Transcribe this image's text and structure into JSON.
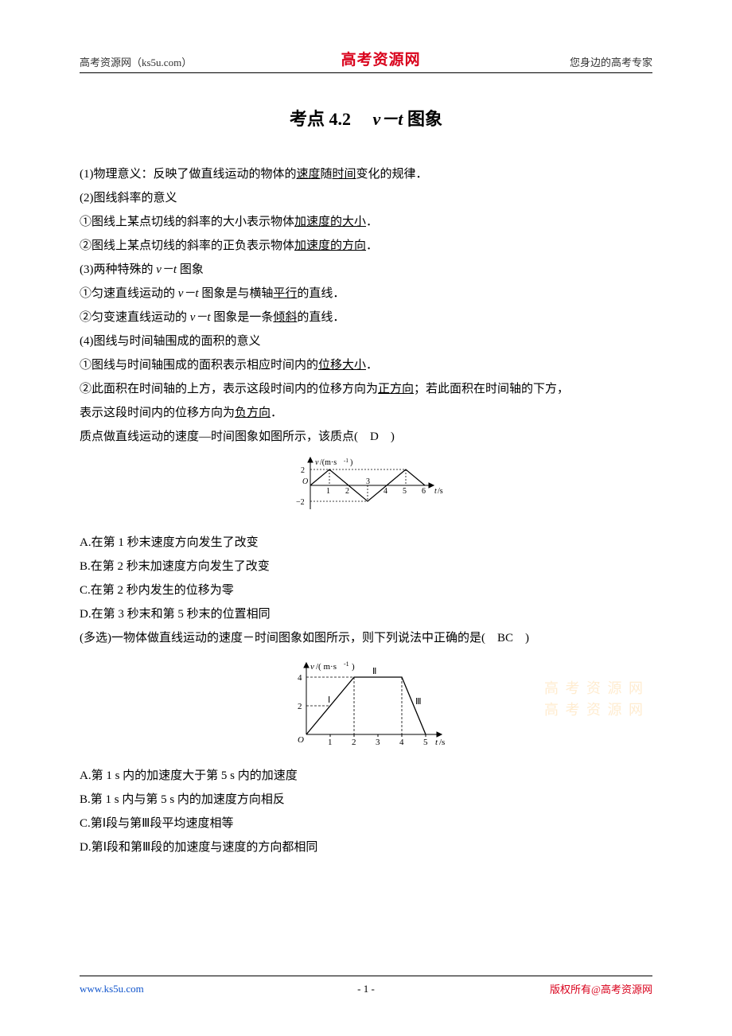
{
  "header": {
    "left": "高考资源网（ks5u.com）",
    "center": "高考资源网",
    "right": "您身边的高考专家"
  },
  "title": {
    "prefix": "考点 4.2",
    "varPart": "v－t",
    "suffix": " 图象"
  },
  "content": {
    "p1a": "(1)物理意义：反映了做直线运动的物体的",
    "p1u1": "速度",
    "p1b": "随",
    "p1u2": "时间",
    "p1c": "变化的规律．",
    "p2": "(2)图线斜率的意义",
    "p3a": "①图线上某点切线的斜率的大小表示物体",
    "p3u": "加速度的大小",
    "p3b": "．",
    "p4a": "②图线上某点切线的斜率的正负表示物体",
    "p4u": "加速度的方向",
    "p4b": "．",
    "p5a": "(3)两种特殊的 ",
    "p5v": "v－t",
    "p5b": " 图象",
    "p6a": "①匀速直线运动的 ",
    "p6v": "v－t",
    "p6b": " 图象是与横轴",
    "p6u": "平行",
    "p6c": "的直线．",
    "p7a": "②匀变速直线运动的 ",
    "p7v": "v－t",
    "p7b": " 图象是一条",
    "p7u": "倾斜",
    "p7c": "的直线．",
    "p8": "(4)图线与时间轴围成的面积的意义",
    "p9a": "①图线与时间轴围成的面积表示相应时间内的",
    "p9u": "位移大小",
    "p9b": "．",
    "p10a": "②此面积在时间轴的上方，表示这段时间内的位移方向为",
    "p10u1": "正方向",
    "p10b": "；若此面积在时间轴的下方，",
    "p10c": "表示这段时间内的位移方向为",
    "p10u2": "负方向",
    "p10d": "．",
    "q1stem": "质点做直线运动的速度—时间图象如图所示，该质点(　D　)",
    "q1A": "A.在第 1 秒末速度方向发生了改变",
    "q1B": "B.在第 2 秒末加速度方向发生了改变",
    "q1C": "C.在第 2 秒内发生的位移为零",
    "q1D": "D.在第 3 秒末和第 5 秒末的位置相同",
    "q2stem": " (多选)一物体做直线运动的速度－时间图象如图所示，则下列说法中正确的是(　BC　)",
    "q2A": "A.第 1 s 内的加速度大于第 5 s 内的加速度",
    "q2B": "B.第 1 s 内与第 5 s 内的加速度方向相反",
    "q2C": "C.第Ⅰ段与第Ⅲ段平均速度相等",
    "q2D": "D.第Ⅰ段和第Ⅲ段的加速度与速度的方向都相同"
  },
  "footer": {
    "left": "www.ks5u.com",
    "center": "- 1 -",
    "right": "版权所有@高考资源网"
  },
  "watermark": {
    "line1": "高 考 资 源 网",
    "line2": "高 考 资 源 网"
  },
  "chart_data": [
    {
      "type": "line",
      "title": "",
      "xlabel": "t/s",
      "ylabel": "v/(m·s⁻¹)",
      "x": [
        0,
        1,
        2,
        3,
        4,
        5,
        6
      ],
      "y": [
        0,
        2,
        0,
        -2,
        0,
        2,
        0
      ],
      "xlim": [
        0,
        6.5
      ],
      "ylim": [
        -2.5,
        2.5
      ],
      "yticks": [
        -2,
        2
      ],
      "xticks": [
        1,
        2,
        3,
        4,
        5,
        6
      ]
    },
    {
      "type": "line",
      "title": "",
      "xlabel": "t/s",
      "ylabel": "v/(m·s⁻¹)",
      "segments": [
        "Ⅰ",
        "Ⅱ",
        "Ⅲ"
      ],
      "x": [
        0,
        2,
        4,
        5
      ],
      "y": [
        0,
        4,
        4,
        0
      ],
      "xlim": [
        0,
        5.5
      ],
      "ylim": [
        0,
        5
      ],
      "yticks": [
        2,
        4
      ],
      "xticks": [
        1,
        2,
        3,
        4,
        5
      ]
    }
  ]
}
